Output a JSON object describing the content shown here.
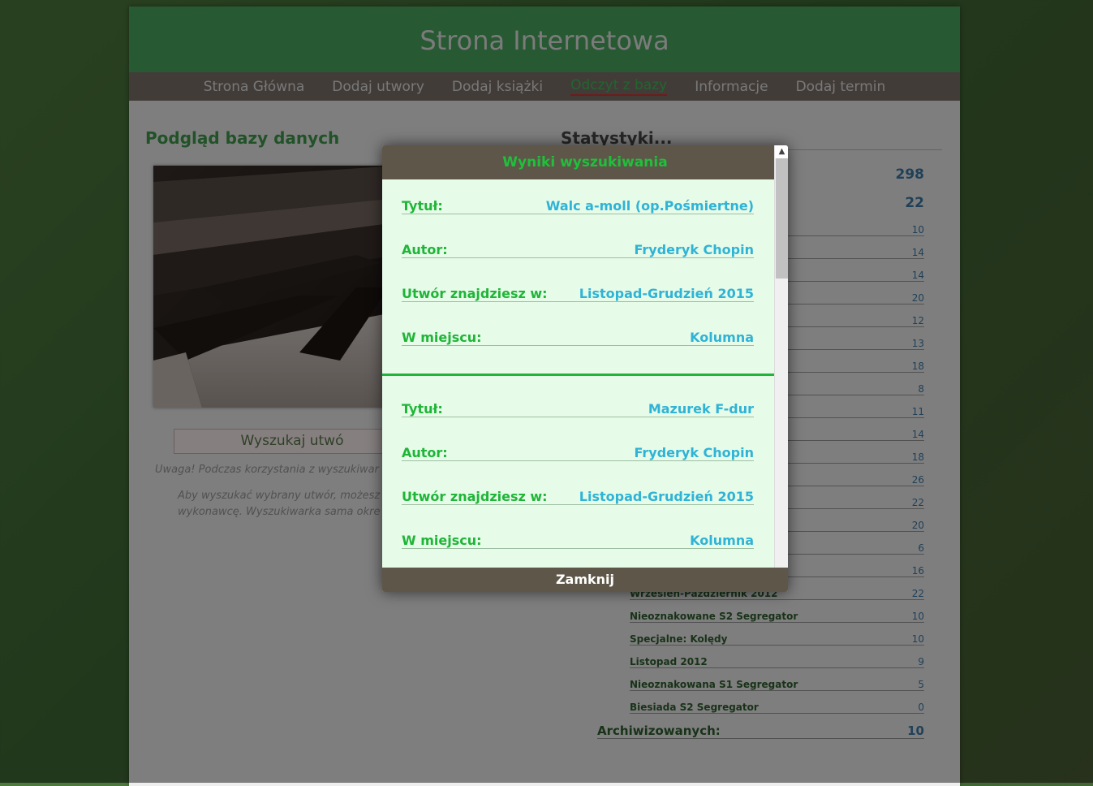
{
  "site": {
    "title": "Strona Internetowa"
  },
  "nav": {
    "items": [
      {
        "label": "Strona Główna"
      },
      {
        "label": "Dodaj utwory"
      },
      {
        "label": "Dodaj książki"
      },
      {
        "label": "Odczyt z bazy"
      },
      {
        "label": "Informacje"
      },
      {
        "label": "Dodaj termin"
      }
    ],
    "active": "Odczyt z bazy"
  },
  "left": {
    "title": "Podgląd bazy danych",
    "search_button": "Wyszukaj utwó",
    "note1": "Uwaga! Podczas korzystania z wyszukiwar",
    "note2": "Aby wyszukać wybrany utwór, możesz wykonawcę. Wyszukiwarka sama okre"
  },
  "stats": {
    "title": "Statystyki...",
    "big_values": [
      "298",
      "22"
    ],
    "rows_values": [
      "10",
      "14",
      "14",
      "20",
      "12",
      "13",
      "18",
      "8",
      "11",
      "14",
      "18",
      "26",
      "22",
      "20",
      "6",
      "16"
    ],
    "named_rows": [
      {
        "name": "Wrzesień-Październik 2012",
        "value": "22"
      },
      {
        "name": "Nieoznakowane S2 Segregator",
        "value": "10"
      },
      {
        "name": "Specjalne: Kolędy",
        "value": "10"
      },
      {
        "name": "Listopad 2012",
        "value": "9"
      },
      {
        "name": "Nieoznakowana S1 Segregator",
        "value": "5"
      },
      {
        "name": "Biesiada S2 Segregator",
        "value": "0"
      }
    ],
    "archived": {
      "label": "Archiwizowanych:",
      "value": "10"
    }
  },
  "modal": {
    "title": "Wyniki wyszukiwania",
    "close_label": "Zamknij",
    "results": [
      {
        "title_label": "Tytuł:",
        "title": "Walc a-moll (op.Pośmiertne)",
        "author_label": "Autor:",
        "author": "Fryderyk Chopin",
        "found_label": "Utwór znajdziesz w:",
        "found": "Listopad-Grudzień 2015",
        "place_label": "W miejscu:",
        "place": "Kolumna"
      },
      {
        "title_label": "Tytuł:",
        "title": "Mazurek F-dur",
        "author_label": "Autor:",
        "author": "Fryderyk Chopin",
        "found_label": "Utwór znajdziesz w:",
        "found": "Listopad-Grudzień 2015",
        "place_label": "W miejscu:",
        "place": "Kolumna"
      }
    ]
  },
  "colors": {
    "header_green": "#4aa85f",
    "nav_bg": "#7d716b",
    "modal_bar": "#5e5648",
    "label_green": "#1fb538",
    "value_blue": "#2fb3d6"
  }
}
